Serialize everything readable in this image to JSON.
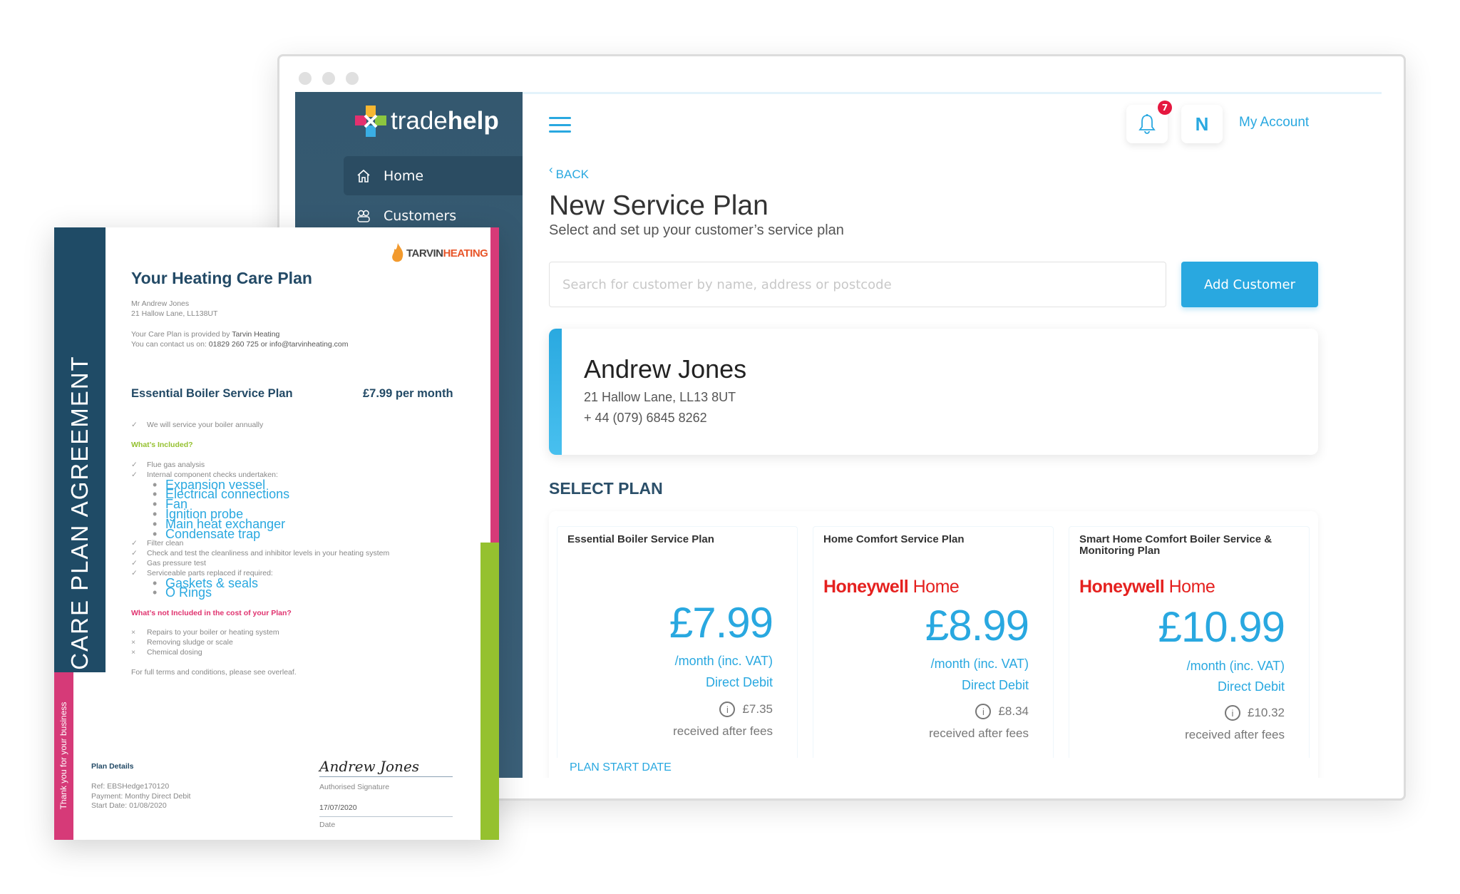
{
  "app": {
    "logo_light": "trade",
    "logo_bold": "help",
    "nav": [
      {
        "label": "Home",
        "icon": "home-icon"
      },
      {
        "label": "Customers",
        "icon": "customers-icon"
      }
    ],
    "header": {
      "notifications": "7",
      "avatar_initial": "N",
      "account_label": "My Account"
    },
    "back_label": "BACK",
    "title": "New Service Plan",
    "subtitle": "Select and set up your customer’s service plan",
    "search_placeholder": "Search for customer by name, address or postcode",
    "add_customer_label": "Add Customer",
    "customer": {
      "name": "Andrew Jones",
      "address": "21 Hallow Lane, LL13 8UT",
      "phone": "+ 44 (079) 6845 8262"
    },
    "select_plan_label": "SELECT PLAN",
    "plans": [
      {
        "title": "Essential Boiler Service Plan",
        "brand": "",
        "price": "£7.99",
        "period": "/month (inc. VAT)",
        "method": "Direct Debit",
        "net": "£7.35",
        "net_label": "received after fees"
      },
      {
        "title": "Home Comfort Service Plan",
        "brand_bold": "Honeywell",
        "brand_light": "Home",
        "price": "£8.99",
        "period": "/month (inc. VAT)",
        "method": "Direct Debit",
        "net": "£8.34",
        "net_label": "received after fees"
      },
      {
        "title": "Smart Home Comfort Boiler Service & Monitoring Plan",
        "brand_bold": "Honeywell",
        "brand_light": "Home",
        "price": "£10.99",
        "period": "/month (inc. VAT)",
        "method": "Direct Debit",
        "net": "£10.32",
        "net_label": "received after fees"
      }
    ],
    "plan_start_label": "PLAN START DATE",
    "colors": {
      "accent": "#29a8e0",
      "sidebar": "#375a70",
      "badge": "#e5173f",
      "honeywell": "#e5211f"
    }
  },
  "document": {
    "side_title": "CARE PLAN AGREEMENT",
    "side_thanks": "Thank you for your business",
    "company_logo": "TARVINHEATING",
    "title": "Your Heating Care Plan",
    "customer_name": "Mr Andrew Jones",
    "customer_address": "21 Hallow Lane, LL138UT",
    "provided_prefix": "Your Care Plan is provided by ",
    "provider": "Tarvin Heating",
    "contact_prefix": "You can contact us on: ",
    "contact": "01829 260 725 or info@tarvinheating.com",
    "plan_name": "Essential Boiler Service Plan",
    "plan_price": "£7.99 per month",
    "intro": "We will service your boiler annually",
    "included_heading": "What’s Included?",
    "included": [
      "Flue gas analysis",
      "Internal component checks undertaken:",
      "Expansion vessel",
      "Electrical connections",
      "Fan",
      "Ignition probe",
      "Main heat exchanger",
      "Condensate trap",
      "Filter clean",
      "Check and test the cleanliness and inhibitor levels in your heating system",
      "Gas pressure test",
      "Serviceable parts replaced if required:",
      "Gaskets & seals",
      "O Rings"
    ],
    "not_included_heading": "What’s not Included in the cost of your Plan?",
    "not_included": [
      "Repairs to your boiler or heating system",
      "Removing sludge or scale",
      "Chemical dosing"
    ],
    "terms": "For full terms and conditions, please see overleaf.",
    "details_heading": "Plan Details",
    "ref": "Ref:  EBSHedge170120",
    "payment": "Payment: Monthy Direct Debit",
    "start_date": "Start Date: 01/08/2020",
    "signature": "Andrew Jones",
    "signature_label": "Authorised Signature",
    "date": "17/07/2020",
    "date_label": "Date",
    "colors": {
      "navy": "#1f4b66",
      "pink": "#d63a78",
      "green": "#95c12f"
    }
  }
}
